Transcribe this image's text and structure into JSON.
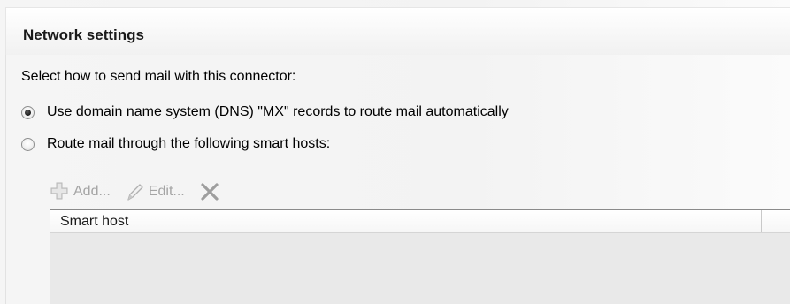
{
  "section": {
    "title": "Network settings"
  },
  "instruction": "Select how to send mail with this connector:",
  "options": [
    {
      "label": "Use domain name system (DNS) \"MX\" records to route mail automatically",
      "selected": true
    },
    {
      "label": "Route mail through the following smart hosts:",
      "selected": false
    }
  ],
  "toolbar": {
    "add_label": "Add...",
    "add_icon": "add-plus-icon",
    "edit_label": "Edit...",
    "edit_icon": "pencil-icon",
    "remove_icon": "remove-x-icon",
    "enabled": false
  },
  "smart_hosts": {
    "columns": [
      "Smart host"
    ],
    "rows": []
  },
  "colors": {
    "disabled_text": "#a4a4a4",
    "grid_background": "#e9e9e9"
  }
}
